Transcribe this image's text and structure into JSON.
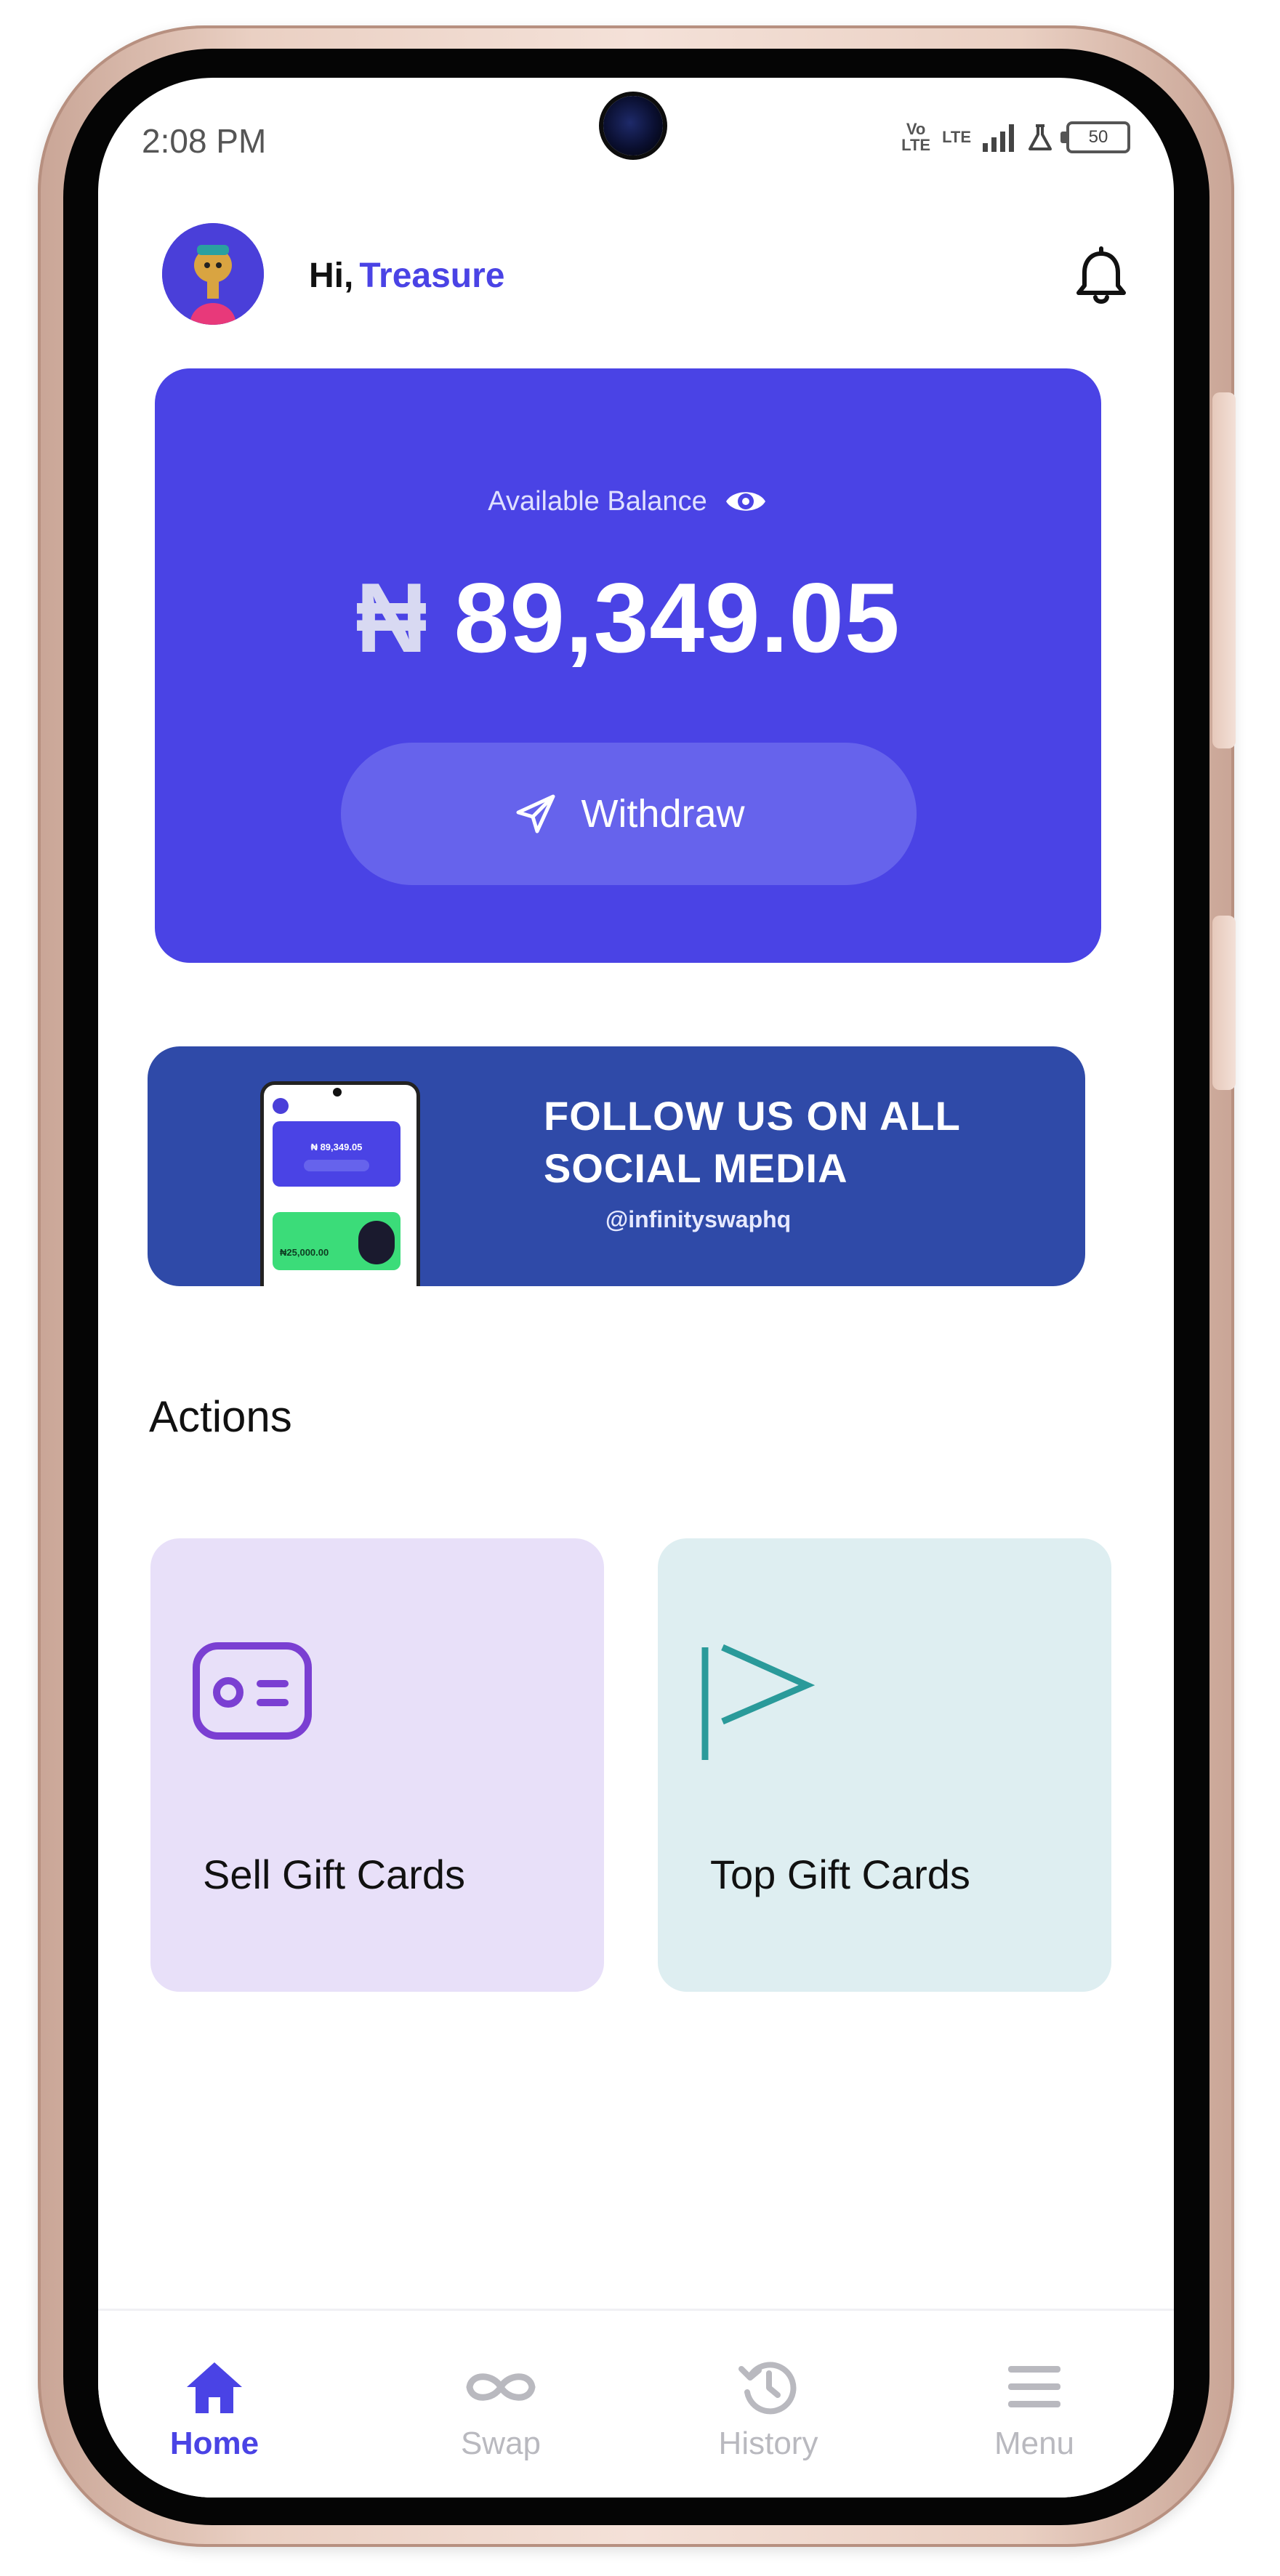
{
  "status_bar": {
    "time": "2:08 PM",
    "network_label_top": "Vo",
    "network_label_bottom": "LTE",
    "lte_label": "LTE",
    "battery_level": "50"
  },
  "header": {
    "greeting_prefix": "Hi,",
    "user_name": "Treasure",
    "bell_icon": "bell-icon"
  },
  "balance_card": {
    "label": "Available Balance",
    "currency_symbol": "₦",
    "amount": "89,349.05",
    "withdraw_label": "Withdraw",
    "eye_icon": "eye-icon",
    "send_icon": "paper-plane-icon"
  },
  "promo_banner": {
    "title_line1": "FOLLOW US ON ALL",
    "title_line2": "SOCIAL MEDIA",
    "handle": "@infinityswaphq",
    "mini_amount": "₦ 89,349.05",
    "mini_green_amount": "₦25,000.00"
  },
  "actions": {
    "title": "Actions",
    "items": [
      {
        "label": "Sell Gift Cards",
        "icon": "id-card-icon",
        "bg": "#e8e0f9",
        "icon_color": "#7a3fd2"
      },
      {
        "label": "Top Gift Cards",
        "icon": "play-send-icon",
        "bg": "#deeef1",
        "icon_color": "#2a9a9a"
      }
    ]
  },
  "bottom_nav": {
    "items": [
      {
        "label": "Home",
        "icon": "home-icon",
        "active": true
      },
      {
        "label": "Swap",
        "icon": "infinity-icon",
        "active": false
      },
      {
        "label": "History",
        "icon": "history-icon",
        "active": false
      },
      {
        "label": "Menu",
        "icon": "menu-icon",
        "active": false
      }
    ]
  },
  "colors": {
    "primary": "#4a43e5",
    "promo_bg": "#2f4aa8",
    "inactive_nav": "#b9b9bf"
  }
}
